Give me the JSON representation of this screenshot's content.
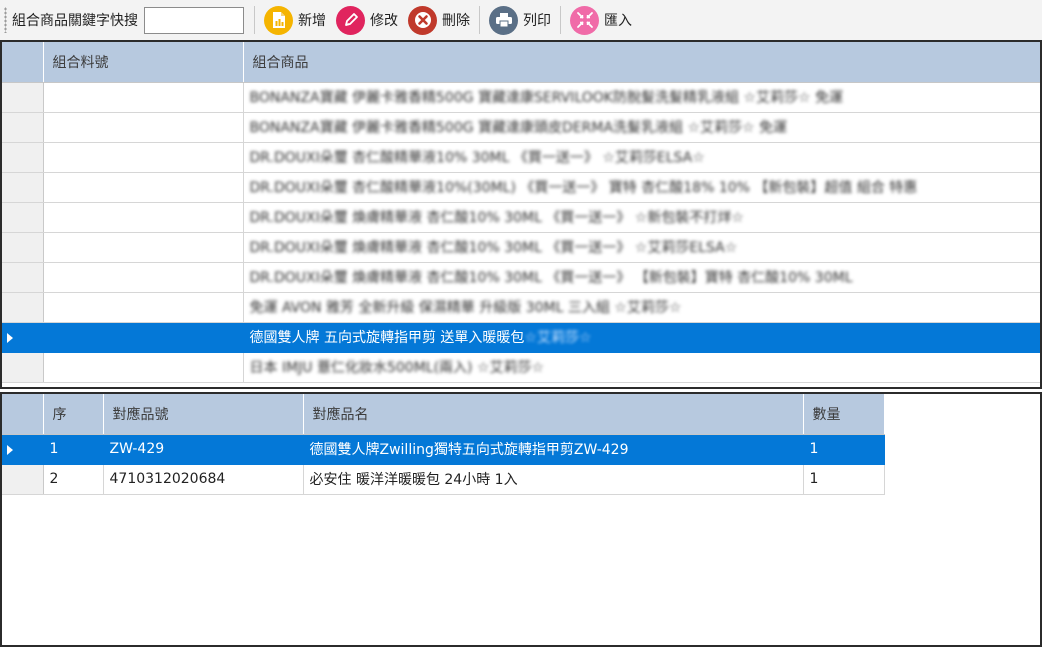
{
  "toolbar": {
    "search_label": "組合商品關鍵字快搜",
    "search_value": "",
    "buttons": [
      {
        "label": "新增",
        "icon": "add-document-icon",
        "color": "#f5b400"
      },
      {
        "label": "修改",
        "icon": "pencil-icon",
        "color": "#e0245e"
      },
      {
        "label": "刪除",
        "icon": "delete-x-icon",
        "color": "#c0392b"
      },
      {
        "label": "列印",
        "icon": "printer-icon",
        "color": "#5a6f86"
      },
      {
        "label": "匯入",
        "icon": "import-arrows-icon",
        "color": "#f06ba8"
      }
    ]
  },
  "top_grid": {
    "columns": [
      "組合料號",
      "組合商品"
    ],
    "rows": [
      {
        "code": "",
        "name": "BONANZA寶藏 伊麗卡雅香精500G 寶藏達康SERVILOOK防脫髮洗髮精乳液組 ☆艾莉莎☆ 免運"
      },
      {
        "code": "",
        "name": "BONANZA寶藏 伊麗卡雅香精500G 寶藏達康頭皮DERMA洗髮乳液組 ☆艾莉莎☆ 免運"
      },
      {
        "code": "",
        "name": "DR.DOUXI朵璽 杏仁酸精華液10% 30ML 《買一送一》 ☆艾莉莎ELSA☆"
      },
      {
        "code": "",
        "name": "DR.DOUXI朵璽 杏仁酸精華液10%(30ML) 《買一送一》 寶特 杏仁酸18% 10% 【新包裝】超值 組合 特惠"
      },
      {
        "code": "",
        "name": "DR.DOUXI朵璽 煥膚精華液 杏仁酸10% 30ML 《買一送一》 ☆新包裝不打烊☆"
      },
      {
        "code": "",
        "name": "DR.DOUXI朵璽 煥膚精華液 杏仁酸10% 30ML 《買一送一》 ☆艾莉莎ELSA☆"
      },
      {
        "code": "",
        "name": "DR.DOUXI朵璽 煥膚精華液 杏仁酸10% 30ML 《買一送一》 【新包裝】寶特 杏仁酸10% 30ML"
      },
      {
        "code": "",
        "name": "免運 AVON 雅芳 全新升級 保濕精華 升級版 30ML 三入組 ☆艾莉莎☆"
      },
      {
        "code": "",
        "name": "德國雙人牌 五向式旋轉指甲剪 送單入暖暖包",
        "name_suffix": "☆艾莉莎☆",
        "selected": true
      },
      {
        "code": "",
        "name": "日本 IMJU 薏仁化妝水500ML(兩入) ☆艾莉莎☆"
      }
    ]
  },
  "bottom_grid": {
    "columns": [
      "序",
      "對應品號",
      "對應品名",
      "數量"
    ],
    "rows": [
      {
        "seq": "1",
        "code": "ZW-429",
        "name": "德國雙人牌Zwilling獨特五向式旋轉指甲剪ZW-429",
        "qty": "1",
        "selected": true
      },
      {
        "seq": "2",
        "code": "4710312020684",
        "name": "必安住 暖洋洋暖暖包 24小時 1入",
        "qty": "1"
      }
    ]
  }
}
